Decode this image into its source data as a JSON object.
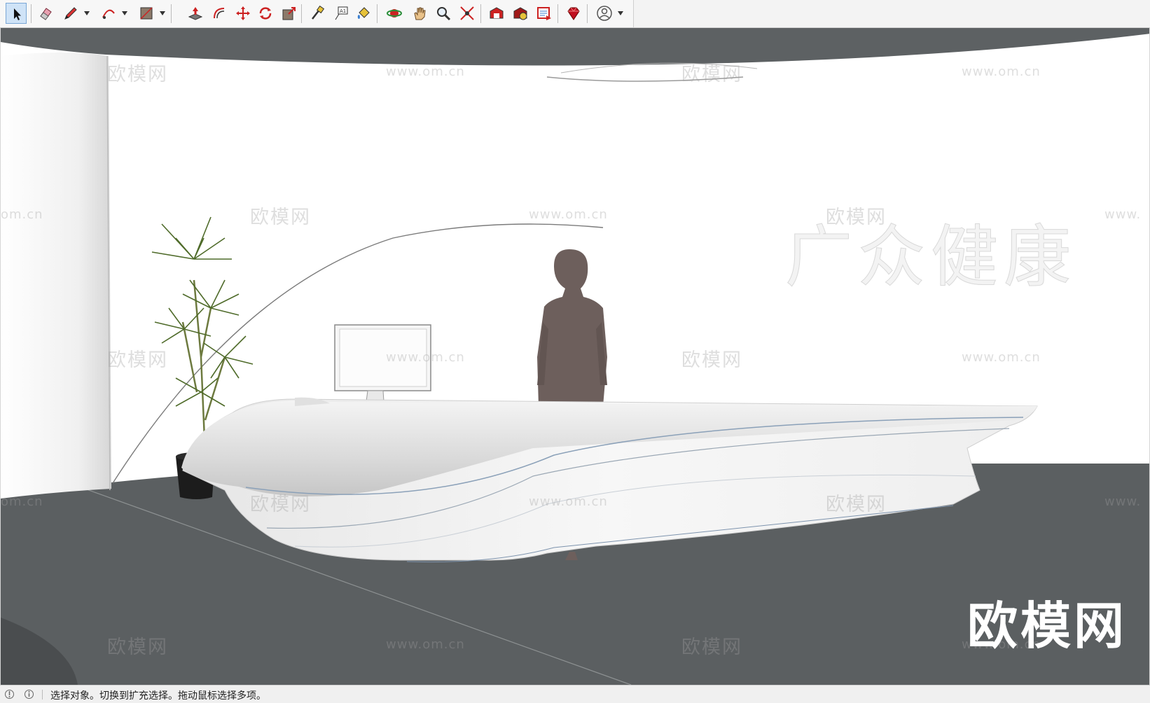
{
  "toolbar": {
    "tools": [
      {
        "name": "select-tool",
        "icon": "arrow-cursor-icon",
        "active": true
      },
      {
        "name": "eraser-tool",
        "icon": "eraser-icon"
      },
      {
        "name": "line-tool",
        "icon": "pencil-icon"
      },
      {
        "name": "arc-tool",
        "icon": "arc-icon"
      },
      {
        "name": "rectangle-tool",
        "icon": "rectangle-icon"
      },
      {
        "name": "push-pull-tool",
        "icon": "push-pull-icon"
      },
      {
        "name": "offset-tool",
        "icon": "offset-icon"
      },
      {
        "name": "move-tool",
        "icon": "move-icon"
      },
      {
        "name": "rotate-tool",
        "icon": "rotate-icon"
      },
      {
        "name": "scale-tool",
        "icon": "scale-icon"
      },
      {
        "name": "tape-measure-tool",
        "icon": "tape-measure-icon"
      },
      {
        "name": "text-tool",
        "icon": "text-label-icon"
      },
      {
        "name": "paint-bucket-tool",
        "icon": "paint-bucket-icon"
      },
      {
        "name": "orbit-tool",
        "icon": "orbit-icon"
      },
      {
        "name": "pan-tool",
        "icon": "hand-icon"
      },
      {
        "name": "zoom-tool",
        "icon": "magnifier-icon"
      },
      {
        "name": "zoom-extents-tool",
        "icon": "zoom-extents-icon"
      },
      {
        "name": "warehouse-tool",
        "icon": "warehouse-icon"
      },
      {
        "name": "extension-warehouse-tool",
        "icon": "extension-icon"
      },
      {
        "name": "layout-tool",
        "icon": "layout-icon"
      },
      {
        "name": "ruby-console-tool",
        "icon": "ruby-gem-icon"
      },
      {
        "name": "account-tool",
        "icon": "user-account-icon"
      }
    ]
  },
  "viewport": {
    "watermark_text": "欧模网",
    "watermark_url": "www.om.cn",
    "watermark_url_partial": "om.cn",
    "watermark_url_partial_right": "www.",
    "logo_text": "欧模网",
    "wall_sign_text": "广众健康"
  },
  "status": {
    "text": "选择对象。切换到扩充选择。拖动鼠标选择多项。"
  }
}
